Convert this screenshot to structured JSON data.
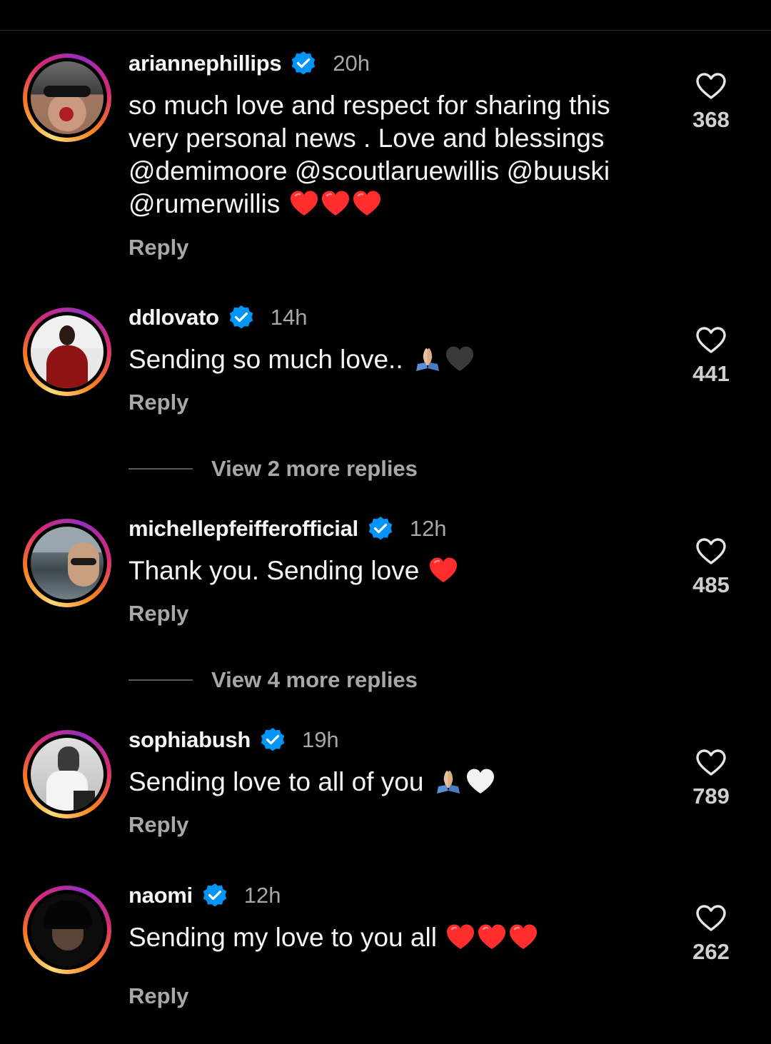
{
  "colors": {
    "background": "#000000",
    "text": "#f5f5f5",
    "secondary": "#a8a8a8",
    "verified": "#0095f6",
    "heart": "#ff2d2d"
  },
  "comments": [
    {
      "username": "ariannephillips",
      "verified": true,
      "time": "20h",
      "text": "so much love and respect for sharing this very personal news . Love and blessings @demimoore @scoutlaruewillis @buuski @rumerwillis",
      "emoji": "red-heart red-heart red-heart",
      "reply": "Reply",
      "likes": "368",
      "heart_icon": "heart-outline-icon"
    },
    {
      "username": "ddlovato",
      "verified": true,
      "time": "14h",
      "text": "Sending so much love..",
      "emoji": "folded-hands black-heart",
      "reply": "Reply",
      "likes": "441",
      "heart_icon": "heart-outline-icon"
    },
    {
      "username": "michellepfeifferofficial",
      "verified": true,
      "time": "12h",
      "text": "Thank you. Sending love",
      "emoji": "red-heart",
      "reply": "Reply",
      "likes": "485",
      "heart_icon": "heart-outline-icon"
    },
    {
      "username": "sophiabush",
      "verified": true,
      "time": "19h",
      "text": "Sending love to all of you",
      "emoji": "folded-hands white-heart",
      "reply": "Reply",
      "likes": "789",
      "heart_icon": "heart-outline-icon"
    },
    {
      "username": "naomi",
      "verified": true,
      "time": "12h",
      "text": "Sending my love to you all",
      "emoji": "red-heart red-heart red-heart",
      "reply": "Reply",
      "likes": "262",
      "heart_icon": "heart-outline-icon"
    }
  ],
  "view_more": [
    {
      "label": "View 2 more replies"
    },
    {
      "label": "View 4 more replies"
    }
  ]
}
